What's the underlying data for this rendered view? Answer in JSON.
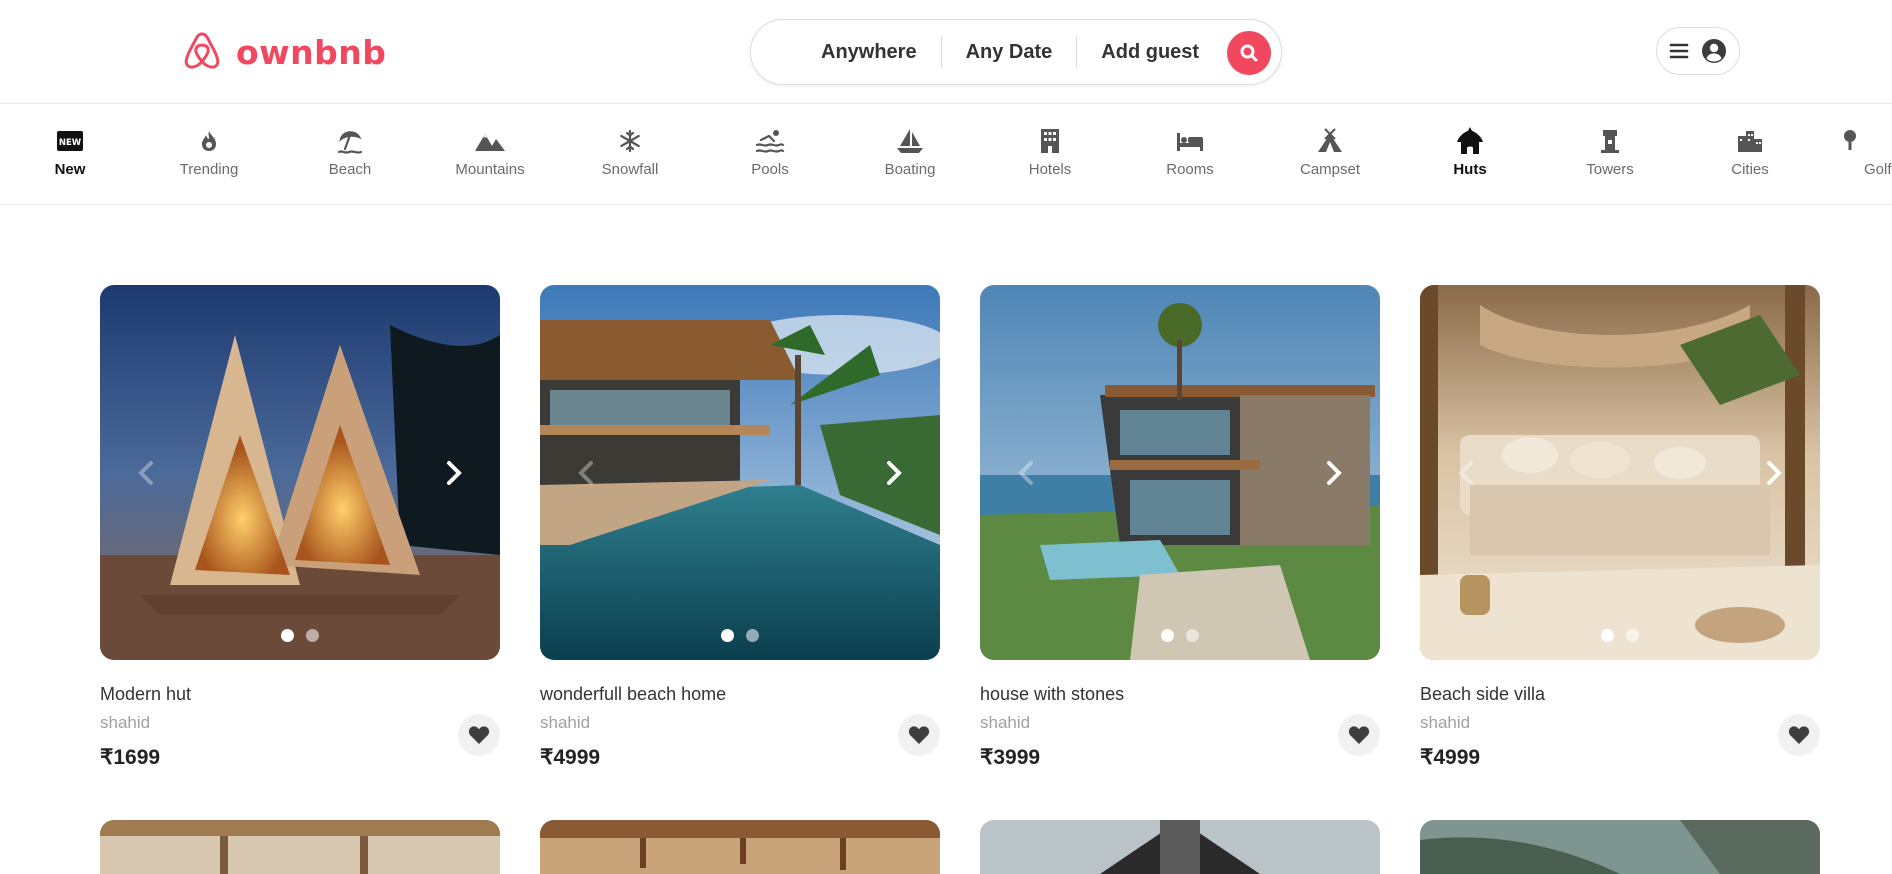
{
  "brand": {
    "name": "ownbnb",
    "color": "#f1485f",
    "icon": "airbnb-logo-icon"
  },
  "search": {
    "location": "Anywhere",
    "date": "Any Date",
    "guests": "Add guest",
    "icon": "search-icon"
  },
  "user_menu": {
    "menu_icon": "hamburger-icon",
    "avatar_icon": "user-circle-icon"
  },
  "categories": [
    {
      "label": "New",
      "icon": "new-badge-icon",
      "active": true
    },
    {
      "label": "Trending",
      "icon": "fire-icon"
    },
    {
      "label": "Beach",
      "icon": "beach-umbrella-icon"
    },
    {
      "label": "Mountains",
      "icon": "mountain-icon"
    },
    {
      "label": "Snowfall",
      "icon": "snowflake-icon"
    },
    {
      "label": "Pools",
      "icon": "swimmer-icon"
    },
    {
      "label": "Boating",
      "icon": "sailboat-icon"
    },
    {
      "label": "Hotels",
      "icon": "building-icon"
    },
    {
      "label": "Rooms",
      "icon": "bed-icon"
    },
    {
      "label": "Campset",
      "icon": "tent-icon"
    },
    {
      "label": "Huts",
      "icon": "hut-icon",
      "active": true
    },
    {
      "label": "Towers",
      "icon": "tower-icon"
    },
    {
      "label": "Cities",
      "icon": "city-icon"
    },
    {
      "label": "Golf",
      "icon": "golf-icon"
    }
  ],
  "listings": [
    {
      "title": "Modern hut",
      "host": "shahid",
      "price": "₹1699"
    },
    {
      "title": "wonderfull beach home",
      "host": "shahid",
      "price": "₹4999"
    },
    {
      "title": "house with stones",
      "host": "shahid",
      "price": "₹3999"
    },
    {
      "title": "Beach side villa",
      "host": "shahid",
      "price": "₹4999"
    }
  ]
}
